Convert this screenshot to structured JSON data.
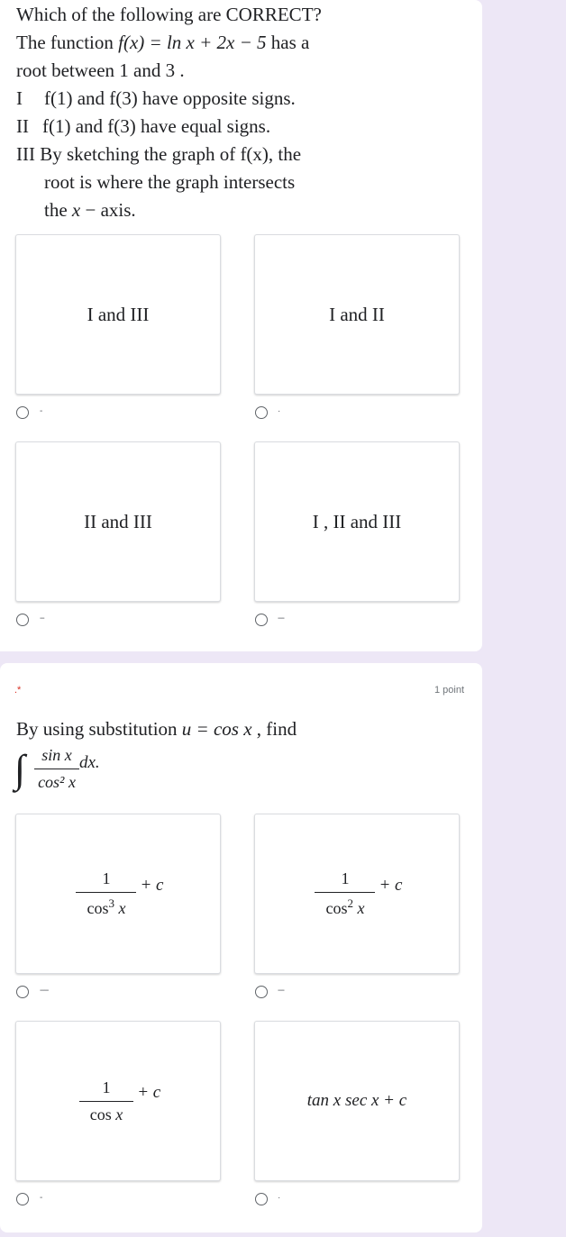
{
  "q1": {
    "lines": [
      "Which of the following are CORRECT?",
      "The function ",
      "root between 1 and 3 .",
      "I",
      "II",
      "III By sketching the graph of ",
      "root is where the graph intersects",
      "the "
    ],
    "fx_expr": "f(x) = ln x + 2x − 5",
    "has_a": " has a",
    "stmt1": "f(1) and f(3) have opposite signs.",
    "stmt2": "f(1) and f(3) have equal signs.",
    "stmt3_tail": "f(x), the",
    "axis_var": "x",
    "axis_tail": " − axis.",
    "options": [
      {
        "text": "I and III",
        "radio_label": "-"
      },
      {
        "text": "I and II",
        "radio_label": "·"
      },
      {
        "text": "II and III",
        "radio_label": "--"
      },
      {
        "text": "I , II and III",
        "radio_label": "---"
      }
    ]
  },
  "q2": {
    "required_marker": ".*",
    "points": "1 point",
    "prompt_start": "By using substitution ",
    "prompt_sub": "u = cos x",
    "prompt_end": " , find",
    "integral_num": "sin x",
    "integral_den": "cos² x",
    "integral_dx": "dx.",
    "options": [
      {
        "num": "1",
        "den_fn": "cos",
        "den_pow": "3",
        "den_var": "x",
        "tail": "+ c",
        "radio_label": "----"
      },
      {
        "num": "1",
        "den_fn": "cos",
        "den_pow": "2",
        "den_var": "x",
        "tail": "+ c",
        "radio_label": "---"
      },
      {
        "num": "1",
        "den_fn": "cos",
        "den_pow": "",
        "den_var": "x",
        "tail": "+ c",
        "radio_label": "-"
      },
      {
        "text": "tan x sec x + c",
        "radio_label": "·"
      }
    ]
  }
}
